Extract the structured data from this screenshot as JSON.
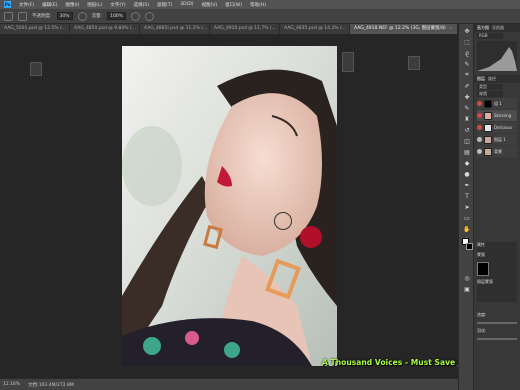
{
  "menubar": {
    "items": [
      "文件(F)",
      "编辑(E)",
      "图像(I)",
      "图层(L)",
      "文字(Y)",
      "选择(S)",
      "滤镜(T)",
      "3D(D)",
      "视图(V)",
      "窗口(W)",
      "帮助(H)"
    ]
  },
  "options": {
    "opacity_label": "不透明度:",
    "opacity_value": "30%",
    "flow_label": "流量:",
    "flow_value": "100%"
  },
  "tabs": [
    {
      "label": "AAG_5001.psd @ 12.5% (...",
      "active": false
    },
    {
      "label": "AAG_4850.psd @ 9.84% (...",
      "active": false
    },
    {
      "label": "AAG_4885I.psd @ 11.2% (...",
      "active": false
    },
    {
      "label": "AAG_4910.psd @ 11.7% (...",
      "active": false
    },
    {
      "label": "AAG_4835.psd @ 14.3% (...",
      "active": false
    },
    {
      "label": "AAG_4918.NEF @ 12.2% (3G, 图层蒙版/8)",
      "active": true
    }
  ],
  "canvas": {
    "credit": "A Thousand Voices - Must Save Jane!"
  },
  "status": {
    "zoom": "12.16%",
    "doc_size": "文档:103.4M/272.8M"
  },
  "panels": {
    "top_tabs": [
      "直方图",
      "导航器"
    ],
    "channel": "RGB",
    "layers_tabs": [
      "图层",
      "路径"
    ],
    "mode_field": "类型",
    "blend_label": "穿透",
    "layers": [
      {
        "name": "组 1",
        "visible": true,
        "selected": false
      },
      {
        "name": "Skinning",
        "visible": true,
        "selected": true
      },
      {
        "name": "Delicious",
        "visible": true,
        "selected": false
      },
      {
        "name": "图层 1",
        "visible": false,
        "selected": false
      },
      {
        "name": "背景",
        "visible": false,
        "selected": false
      }
    ],
    "properties_title": "属性",
    "mask_label": "蒙版",
    "layer_mask_label": "图层蒙版",
    "density_label": "浓度:",
    "feather_label": "羽化:"
  },
  "colors": {
    "accent": "#31a8ff",
    "credit": "#a8ff3e",
    "eye_on": "#dd4444",
    "canvas_bg": "#262626"
  }
}
